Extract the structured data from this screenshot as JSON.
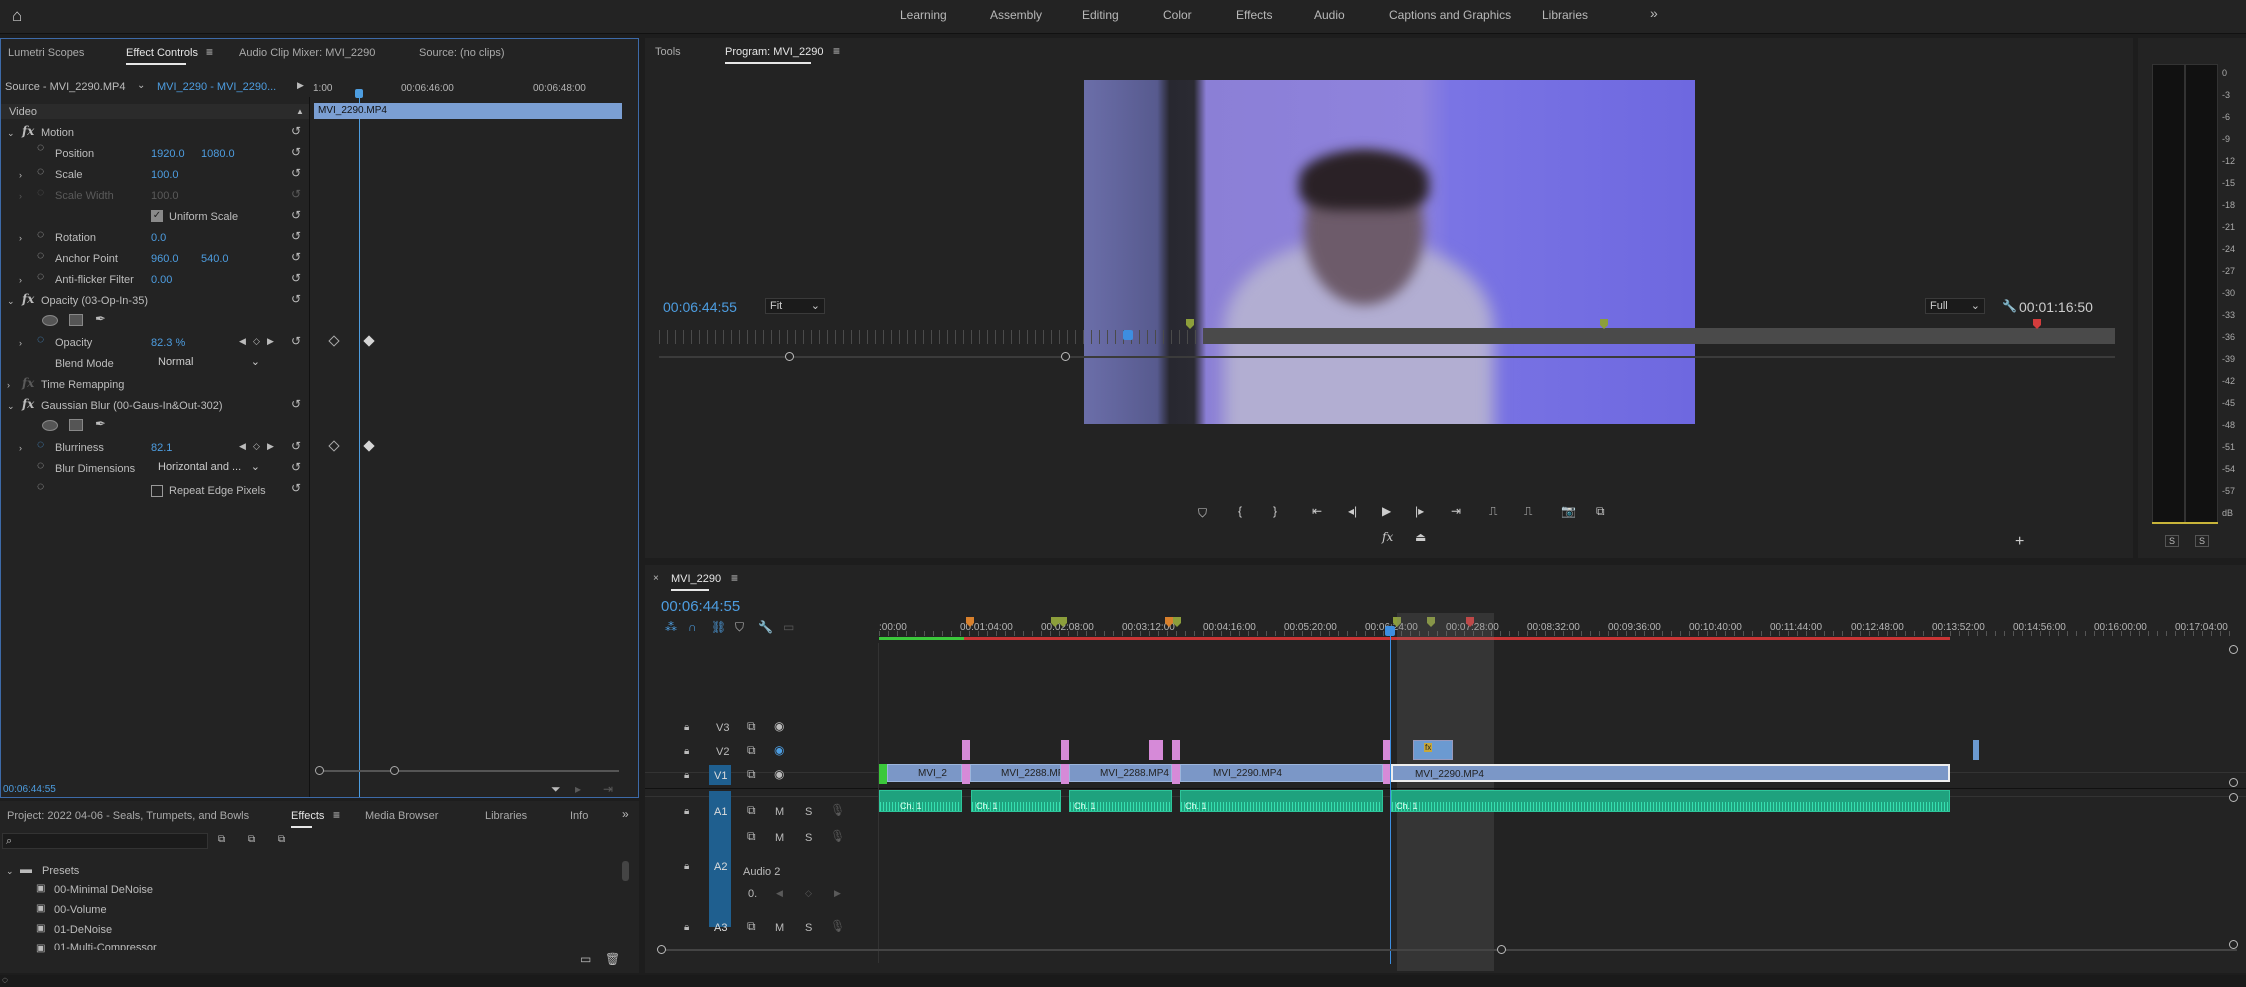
{
  "workspaces": [
    "Learning",
    "Assembly",
    "Editing",
    "Color",
    "Effects",
    "Audio",
    "Captions and Graphics",
    "Libraries"
  ],
  "more_icon": "»",
  "left_panel": {
    "tabs": [
      "Lumetri Scopes",
      "Effect Controls",
      "Audio Clip Mixer: MVI_2290",
      "Source: (no clips)"
    ],
    "source_selector": "Source - MVI_2290.MP4",
    "sequence_selector": "MVI_2290 - MVI_2290...",
    "ruler": [
      "1:00",
      "00:06:46:00",
      "00:06:48:00"
    ],
    "clip_name": "MVI_2290.MP4",
    "section_video": "Video",
    "motion": {
      "label": "Motion",
      "position": {
        "label": "Position",
        "x": "1920.0",
        "y": "1080.0"
      },
      "scale": {
        "label": "Scale",
        "value": "100.0"
      },
      "scale_width": {
        "label": "Scale Width",
        "value": "100.0"
      },
      "uniform_scale": "Uniform Scale",
      "rotation": {
        "label": "Rotation",
        "value": "0.0"
      },
      "anchor": {
        "label": "Anchor Point",
        "x": "960.0",
        "y": "540.0"
      },
      "antiflicker": {
        "label": "Anti-flicker Filter",
        "value": "0.00"
      }
    },
    "opacity": {
      "label": "Opacity (03-Op-In-35)",
      "opacity": {
        "label": "Opacity",
        "value": "82.3 %"
      },
      "blend": {
        "label": "Blend Mode",
        "value": "Normal"
      }
    },
    "time_remapping": "Time Remapping",
    "gaussian": {
      "label": "Gaussian Blur (00-Gaus-In&Out-302)",
      "blurriness": {
        "label": "Blurriness",
        "value": "82.1"
      },
      "dimensions": {
        "label": "Blur Dimensions",
        "value": "Horizontal and ..."
      },
      "repeat": "Repeat Edge Pixels"
    },
    "timecode": "00:06:44:55"
  },
  "project_panel": {
    "tabs": [
      "Project: 2022 04-06 - Seals, Trumpets, and Bowls",
      "Effects",
      "Media Browser",
      "Libraries",
      "Info"
    ],
    "presets_folder": "Presets",
    "items": [
      "00-Minimal DeNoise",
      "00-Volume",
      "01-DeNoise",
      "01-Multi-Compressor"
    ]
  },
  "program": {
    "tabs": [
      "Tools",
      "Program: MVI_2290"
    ],
    "timecode_left": "00:06:44:55",
    "fit": "Fit",
    "quality": "Full",
    "timecode_right": "00:01:16:50"
  },
  "timeline": {
    "sequence_name": "MVI_2290",
    "timecode": "00:06:44:55",
    "ruler": [
      ":00:00",
      "00:01:04:00",
      "00:02:08:00",
      "00:03:12:00",
      "00:04:16:00",
      "00:05:20:00",
      "00:06:24:00",
      "00:07:28:00",
      "00:08:32:00",
      "00:09:36:00",
      "00:10:40:00",
      "00:11:44:00",
      "00:12:48:00",
      "00:13:52:00",
      "00:14:56:00",
      "00:16:00:00",
      "00:17:04:00"
    ],
    "tracks": [
      "V3",
      "V2",
      "V1",
      "A1",
      "A2",
      "A3"
    ],
    "audio2_label": "Audio 2",
    "audio2_volume": "0.",
    "clips_v1": [
      "MVI_2",
      "MVI_2288.MP",
      "MVI_2288.MP4",
      "MVI_2290.MP4",
      "MVI_2290.MP4"
    ],
    "ch_label": "Ch. 1"
  },
  "meter": {
    "scale": [
      "0",
      "-3",
      "-6",
      "-9",
      "-12",
      "-15",
      "-18",
      "-21",
      "-24",
      "-27",
      "-30",
      "-33",
      "-36",
      "-39",
      "-42",
      "-45",
      "-48",
      "-51",
      "-54",
      "-57",
      "dB"
    ],
    "solo": "S"
  },
  "colors": {
    "accent": "#4d9de0",
    "clip_video": "#7b97c7",
    "clip_audio": "#1fa27e",
    "clip_pink": "#d68ad8"
  }
}
